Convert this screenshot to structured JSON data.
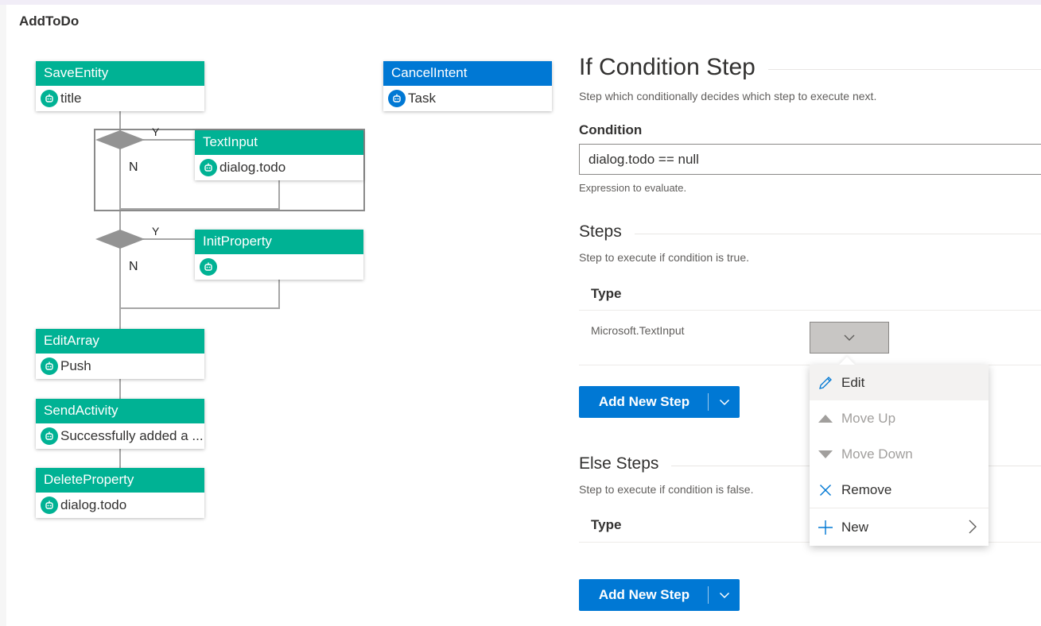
{
  "page": {
    "title": "AddToDo"
  },
  "flow": {
    "branch_yes": "Y",
    "branch_no": "N",
    "nodes": [
      {
        "id": "save-entity",
        "title": "SaveEntity",
        "body": "title",
        "color": "#00b294"
      },
      {
        "id": "cancel-intent",
        "title": "CancelIntent",
        "body": "Task",
        "color": "#0078d4"
      },
      {
        "id": "text-input",
        "title": "TextInput",
        "body": "dialog.todo",
        "color": "#00b294"
      },
      {
        "id": "init-property",
        "title": "InitProperty",
        "body": "",
        "color": "#00b294"
      },
      {
        "id": "edit-array",
        "title": "EditArray",
        "body": "Push",
        "color": "#00b294"
      },
      {
        "id": "send-activity",
        "title": "SendActivity",
        "body": "Successfully added a ...",
        "color": "#00b294"
      },
      {
        "id": "delete-property",
        "title": "DeleteProperty",
        "body": "dialog.todo",
        "color": "#00b294"
      }
    ]
  },
  "panel": {
    "title": "If Condition Step",
    "description": "Step which conditionally decides which step to execute next.",
    "condition_label": "Condition",
    "condition_value": "dialog.todo == null",
    "condition_hint": "Expression to evaluate.",
    "steps": {
      "title": "Steps",
      "description": "Step to execute if condition is true.",
      "type_header": "Type",
      "rows": [
        {
          "type": "Microsoft.TextInput"
        }
      ],
      "add_button": "Add New Step"
    },
    "else_steps": {
      "title": "Else Steps",
      "description": "Step to execute if condition is false.",
      "type_header": "Type",
      "add_button": "Add New Step"
    }
  },
  "context_menu": {
    "items": [
      {
        "label": "Edit",
        "icon": "pencil-icon",
        "disabled": false
      },
      {
        "label": "Move Up",
        "icon": "triangle-up-icon",
        "disabled": true
      },
      {
        "label": "Move Down",
        "icon": "triangle-down-icon",
        "disabled": true
      },
      {
        "label": "Remove",
        "icon": "close-icon",
        "disabled": false
      },
      {
        "label": "New",
        "icon": "plus-icon",
        "disabled": false
      }
    ]
  },
  "colors": {
    "accent": "#0078d4",
    "node_green": "#00b294",
    "node_blue": "#0078d4"
  }
}
